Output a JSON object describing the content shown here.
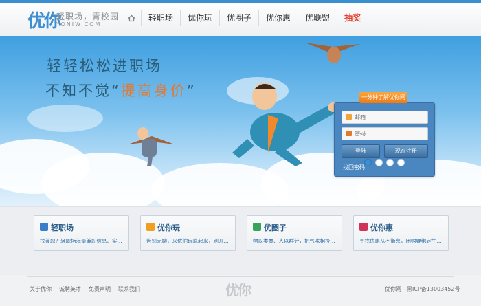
{
  "header": {
    "logo_mark": "优你",
    "logo_slogan": "轻职场，青校园",
    "logo_domain": "YONIW.COM",
    "nav": [
      {
        "label": "轻职场"
      },
      {
        "label": "优你玩"
      },
      {
        "label": "优圈子"
      },
      {
        "label": "优你惠"
      },
      {
        "label": "优联盟"
      },
      {
        "label": "抽奖"
      }
    ]
  },
  "banner": {
    "headline_line1": "轻轻松松进职场",
    "headline_line2_prefix": "不知不觉“",
    "headline_line2_emphasis": "提高身价",
    "headline_line2_suffix": "”"
  },
  "login": {
    "tag": "一分钟了解优你网",
    "email_placeholder": "邮箱",
    "password_placeholder": "密码",
    "login_button": "登陆",
    "register_button": "现在注册",
    "forgot_link": "找回密码"
  },
  "carousel": {
    "active_index": 0,
    "count": 4
  },
  "cards": [
    {
      "title": "轻职场",
      "desc": "找兼职？轻职场海量兼职信息、实...",
      "color": "#3a7fc7"
    },
    {
      "title": "优你玩",
      "desc": "告别无聊，来优你玩疯起来，别开...",
      "color": "#f0a020"
    },
    {
      "title": "优圈子",
      "desc": "物以类聚、人以群分，把气味相投...",
      "color": "#3aa35a"
    },
    {
      "title": "优你惠",
      "desc": "寻找优惠从不衡怠，团购要绑定生...",
      "color": "#d0335a"
    }
  ],
  "footer": {
    "links": [
      "关于优你",
      "诚聘英才",
      "免责声明",
      "联系我们"
    ],
    "logo": "优你",
    "site_name": "优你网",
    "icp": "黑ICP备13003452号"
  },
  "colors": {
    "brand_blue": "#3a8fd0",
    "accent_orange": "#e9762a",
    "highlight_red": "#e43b2c"
  }
}
